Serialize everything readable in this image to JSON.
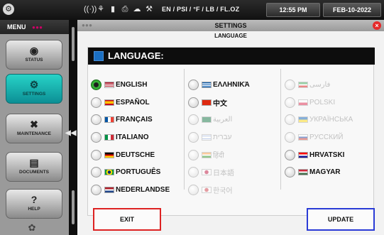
{
  "topbar": {
    "units": "EN / PSI / °F / LB / FL.OZ",
    "time": "12:55 PM",
    "date": "FEB-10-2022",
    "icons": [
      "wifi-icon",
      "network-icon",
      "battery-icon",
      "print-icon",
      "cloud-icon",
      "wrench-status-icon"
    ]
  },
  "sidebar": {
    "title": "MENU",
    "items": [
      {
        "label": "STATUS",
        "icon": "gauge-icon",
        "active": false
      },
      {
        "label": "SETTINGS",
        "icon": "gear-icon",
        "active": true
      },
      {
        "label": "MAINTENANCE",
        "icon": "tools-icon",
        "active": false
      },
      {
        "label": "DOCUMENTS",
        "icon": "document-icon",
        "active": false
      },
      {
        "label": "HELP",
        "icon": "help-icon",
        "active": false
      }
    ]
  },
  "panel": {
    "title": "SETTINGS",
    "subtitle": "LANGUAGE"
  },
  "language": {
    "heading": "LANGUAGE:",
    "selected": "ENGLISH",
    "columns": [
      [
        {
          "label": "ENGLISH",
          "flag": "us",
          "enabled": true,
          "checked": true
        },
        {
          "label": "ESPAÑOL",
          "flag": "es",
          "enabled": true,
          "checked": false
        },
        {
          "label": "FRANÇAIS",
          "flag": "fr",
          "enabled": true,
          "checked": false
        },
        {
          "label": "ITALIANO",
          "flag": "it",
          "enabled": true,
          "checked": false
        },
        {
          "label": "DEUTSCHE",
          "flag": "de",
          "enabled": true,
          "checked": false
        },
        {
          "label": "PORTUGUÊS",
          "flag": "br",
          "enabled": true,
          "checked": false
        },
        {
          "label": "NEDERLANDSE",
          "flag": "nl",
          "enabled": true,
          "checked": false
        }
      ],
      [
        {
          "label": "ΕΛΛΗΝΙΚΆ",
          "flag": "gr",
          "enabled": true,
          "checked": false
        },
        {
          "label": "中文",
          "flag": "cn",
          "enabled": true,
          "checked": false
        },
        {
          "label": "العربية",
          "flag": "sa",
          "enabled": false,
          "checked": false
        },
        {
          "label": "עברית",
          "flag": "il",
          "enabled": false,
          "checked": false
        },
        {
          "label": "हिंदी",
          "flag": "in",
          "enabled": false,
          "checked": false
        },
        {
          "label": "日本語",
          "flag": "jp",
          "enabled": false,
          "checked": false
        },
        {
          "label": "한국어",
          "flag": "kr",
          "enabled": false,
          "checked": false
        }
      ],
      [
        {
          "label": "فارسی",
          "flag": "ir",
          "enabled": false,
          "checked": false
        },
        {
          "label": "POLSKI",
          "flag": "pl",
          "enabled": false,
          "checked": false
        },
        {
          "label": "УКРАЇНСЬКА",
          "flag": "ua",
          "enabled": false,
          "checked": false
        },
        {
          "label": "РУССКИЙ",
          "flag": "ru",
          "enabled": false,
          "checked": false
        },
        {
          "label": "HRVATSKI",
          "flag": "hr",
          "enabled": true,
          "checked": false
        },
        {
          "label": "MAGYAR",
          "flag": "hu",
          "enabled": true,
          "checked": false
        }
      ]
    ]
  },
  "buttons": {
    "exit": "EXIT",
    "update": "UPDATE"
  },
  "colors": {
    "active_menu": "#1bb8b0",
    "exit_border": "#dd2222",
    "update_border": "#2a3bd6",
    "close_button": "#e52a2a"
  }
}
